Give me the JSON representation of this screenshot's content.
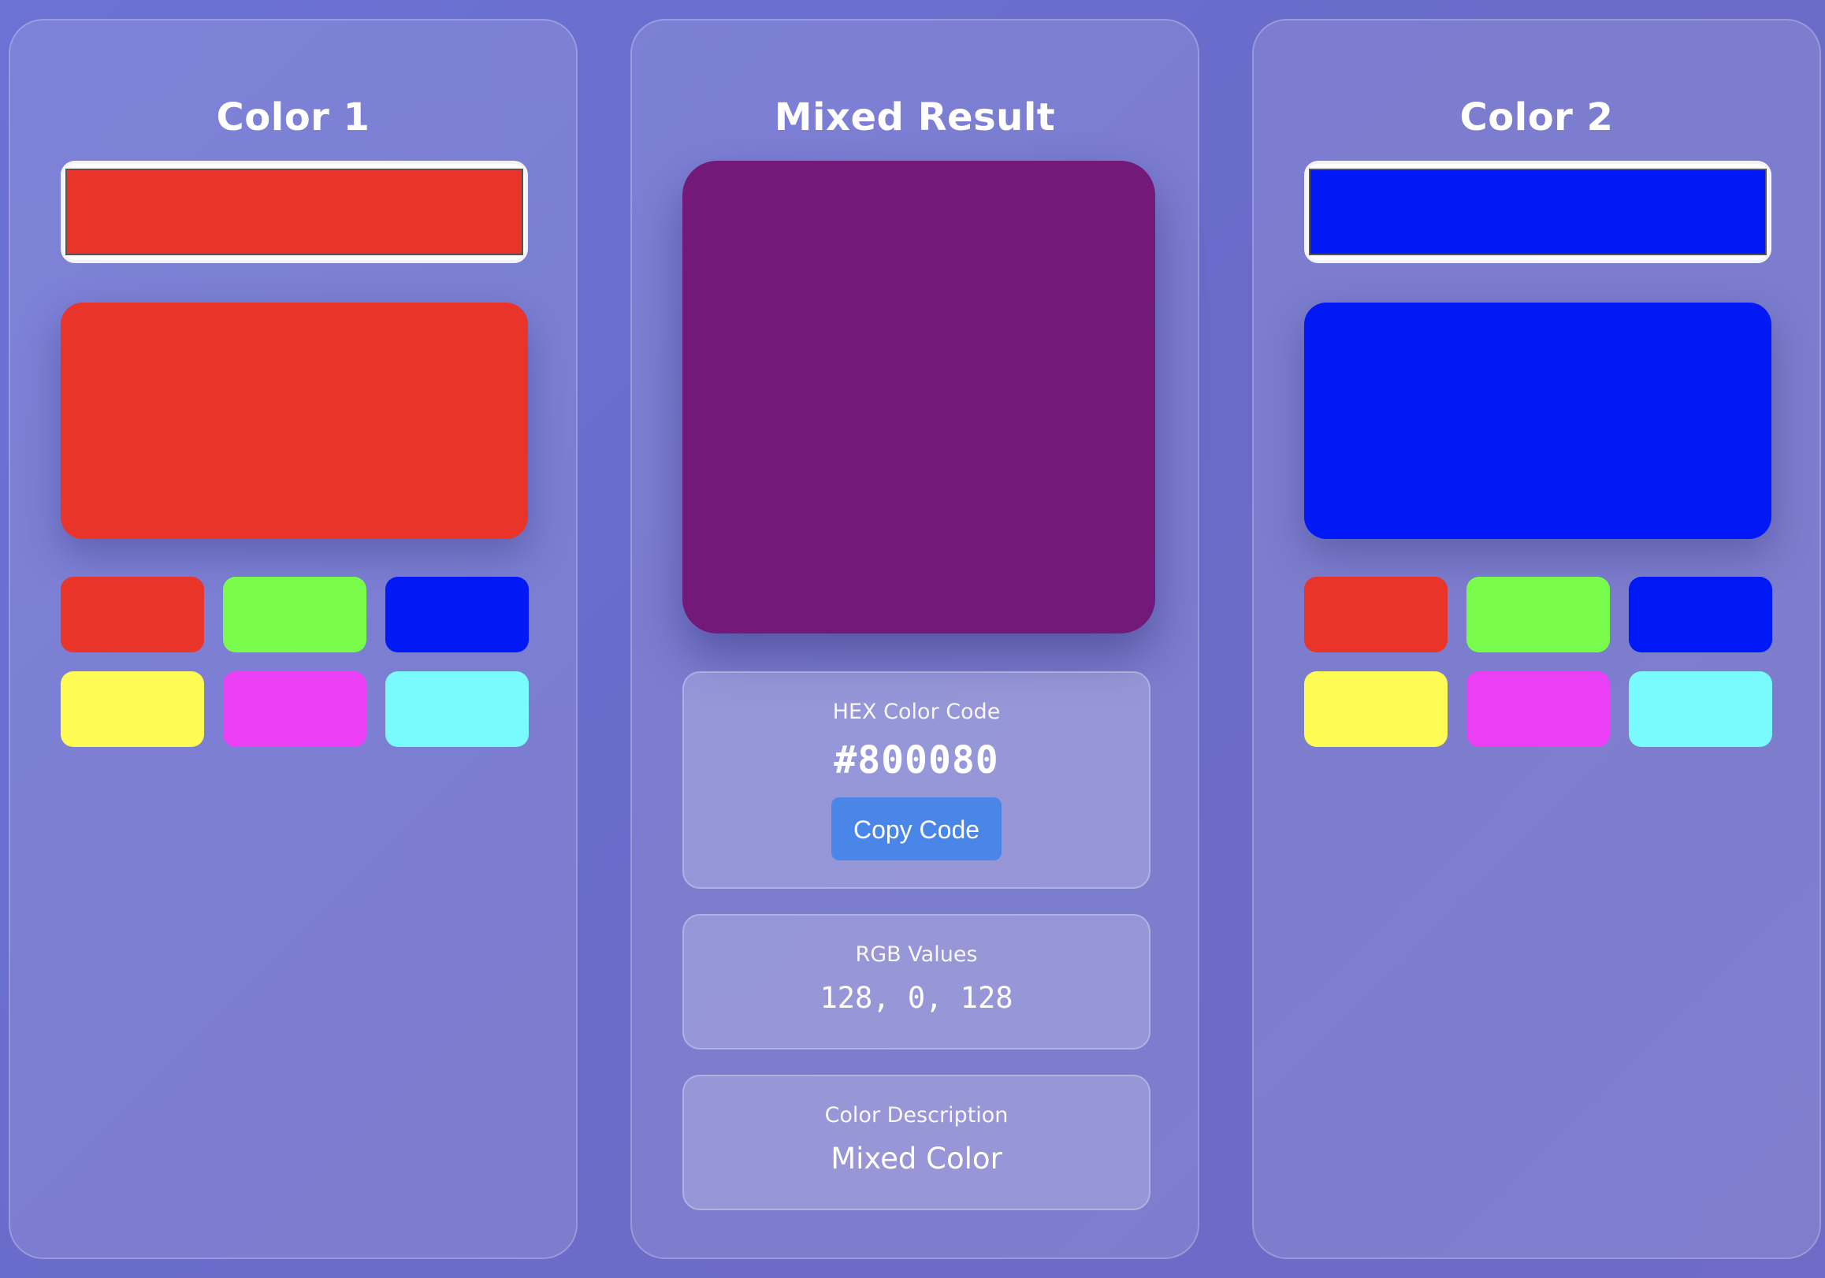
{
  "panels": {
    "color1": {
      "title": "Color 1",
      "selected_color": "#e9342a",
      "swatches": [
        "#e9342a",
        "#78fb4a",
        "#0019f5",
        "#fdfb54",
        "#eb3ff5",
        "#79fbfd"
      ]
    },
    "mixed": {
      "title": "Mixed Result",
      "color": "#73197a",
      "hex_label": "HEX Color Code",
      "hex_value": "#800080",
      "copy_button": "Copy Code",
      "rgb_label": "RGB Values",
      "rgb_value": "128, 0, 128",
      "desc_label": "Color Description",
      "desc_value": "Mixed Color"
    },
    "color2": {
      "title": "Color 2",
      "selected_color": "#0019f5",
      "swatches": [
        "#e9342a",
        "#78fb4a",
        "#0019f5",
        "#fdfb54",
        "#eb3ff5",
        "#79fbfd"
      ]
    }
  }
}
